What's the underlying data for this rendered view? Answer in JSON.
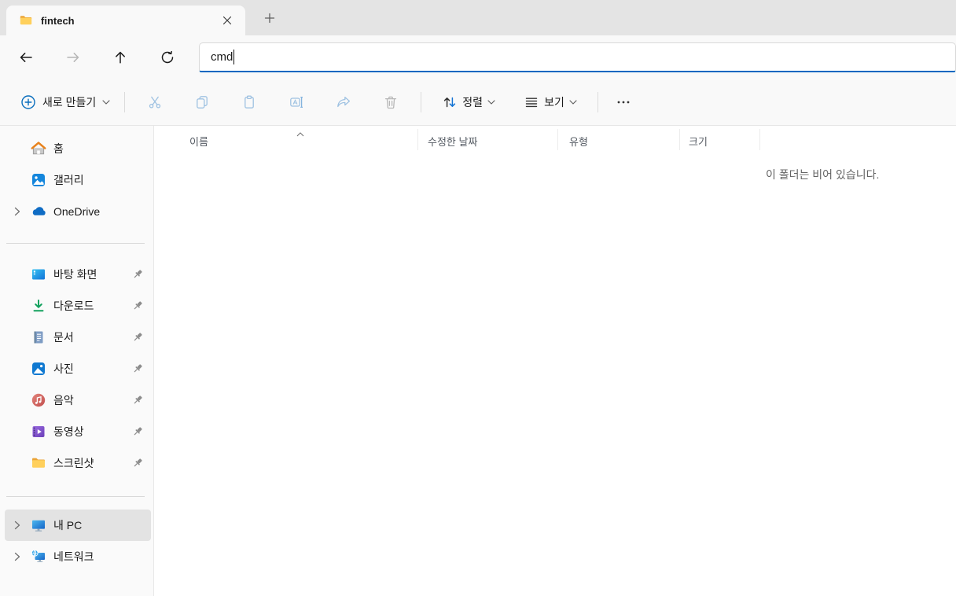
{
  "window": {
    "tab_title": "fintech"
  },
  "navigation": {
    "address_value": "cmd"
  },
  "toolbar": {
    "new_label": "새로 만들기",
    "sort_label": "정렬",
    "view_label": "보기"
  },
  "sidebar": {
    "items": [
      {
        "label": "홈",
        "icon": "home"
      },
      {
        "label": "갤러리",
        "icon": "gallery"
      },
      {
        "label": "OneDrive",
        "icon": "onedrive",
        "expandable": true
      },
      {
        "label": "바탕 화면",
        "icon": "desktop",
        "pinned": true
      },
      {
        "label": "다운로드",
        "icon": "downloads",
        "pinned": true
      },
      {
        "label": "문서",
        "icon": "documents",
        "pinned": true
      },
      {
        "label": "사진",
        "icon": "pictures",
        "pinned": true
      },
      {
        "label": "음악",
        "icon": "music",
        "pinned": true
      },
      {
        "label": "동영상",
        "icon": "videos",
        "pinned": true
      },
      {
        "label": "스크린샷",
        "icon": "folder",
        "pinned": true
      },
      {
        "label": "내 PC",
        "icon": "computer",
        "expandable": true,
        "selected": true
      },
      {
        "label": "네트워크",
        "icon": "network",
        "expandable": true
      }
    ]
  },
  "main": {
    "columns": [
      {
        "label": "이름",
        "sorted": "asc"
      },
      {
        "label": "수정한 날짜"
      },
      {
        "label": "유형"
      },
      {
        "label": "크기"
      }
    ],
    "empty_message": "이 폴더는 비어 있습니다."
  },
  "colors": {
    "accent": "#0067c0",
    "disabled_icon_blue": "#9fc2e2",
    "disabled_icon_gray": "#b7b7b7",
    "chrome_background": "#f9f9f9",
    "tabbar_background": "#e4e4e4",
    "selected_row_background": "#e3e3e3"
  }
}
